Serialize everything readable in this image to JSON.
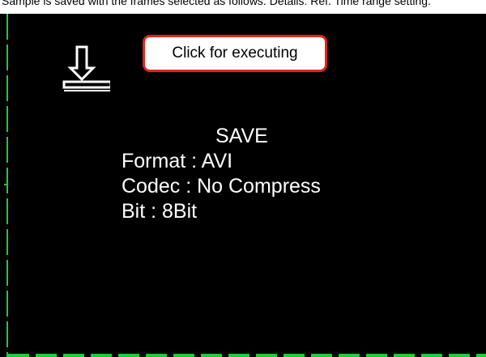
{
  "window": {
    "caption": "Sample is saved with the frames selected as follows. Details: Ref. Time range setting."
  },
  "callout": {
    "label": "Click for executing"
  },
  "save_panel": {
    "title": "SAVE",
    "lines": [
      "Format : AVI",
      "Codec : No Compress",
      "Bit : 8Bit"
    ]
  },
  "icons": {
    "save": "download-to-tray-icon"
  },
  "colors": {
    "background": "#000000",
    "text": "#ffffff",
    "border_dashes": "#22c93a",
    "callout_border": "#e0241d"
  }
}
